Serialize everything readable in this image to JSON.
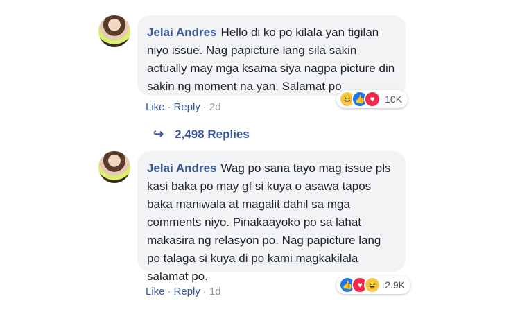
{
  "comments": [
    {
      "author": "Jelai Andres",
      "text": "Hello di ko po kilala yan tigilan niyo issue. Nag papicture lang sila sakin actually may mga ksama siya nagpa picture din sakin ng moment na yan. Salamat po",
      "reaction_count": "10K",
      "reactions": [
        "haha",
        "like",
        "love"
      ],
      "like_label": "Like",
      "reply_label": "Reply",
      "time": "2d"
    },
    {
      "author": "Jelai Andres",
      "text": "Wag po sana tayo mag issue pls kasi baka po may gf si kuya o asawa tapos baka maniwala at magalit dahil sa mga comments niyo. Pinakaayoko po sa lahat makasira ng relasyon po. Nag papicture lang po talaga si kuya di po kami magkakilala salamat po.",
      "reaction_count": "2.9K",
      "reactions": [
        "like",
        "love",
        "haha"
      ],
      "like_label": "Like",
      "reply_label": "Reply",
      "time": "1d"
    }
  ],
  "replies_label": "2,498 Replies",
  "colors": {
    "link": "#385898",
    "bubble": "#f2f3f5",
    "meta": "#90949c"
  }
}
